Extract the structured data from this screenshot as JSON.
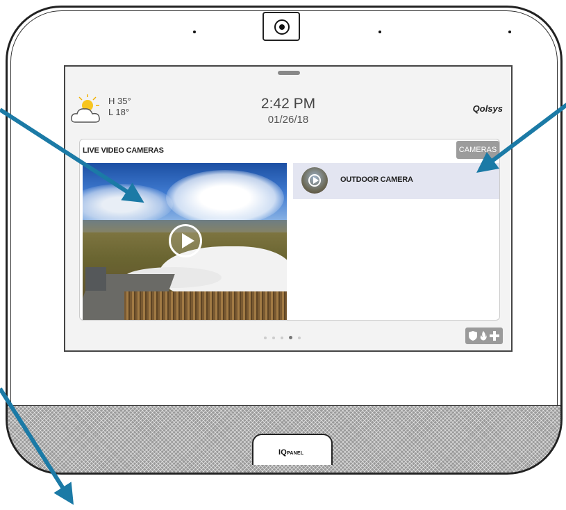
{
  "device": {
    "brand": "IQ",
    "brand_sub": "PANEL"
  },
  "header": {
    "weather_high": "H 35°",
    "weather_low": "L 18°",
    "time": "2:42 PM",
    "date": "01/26/18",
    "logo": "Qolsys"
  },
  "cameras_panel": {
    "title": "LIVE VIDEO CAMERAS",
    "cameras_button": "CAMERAS",
    "camera_list": [
      {
        "name": "OUTDOOR CAMERA"
      }
    ]
  },
  "pager": {
    "page_count": 5,
    "active_page": 4
  },
  "colors": {
    "arrow": "#1b7aa6",
    "list_highlight": "#e3e5f1",
    "button_gray": "#9c9c9c"
  },
  "icons": [
    "camera-lens-icon",
    "weather-icon",
    "play-icon",
    "shield-icon",
    "fire-icon",
    "medical-plus-icon"
  ]
}
